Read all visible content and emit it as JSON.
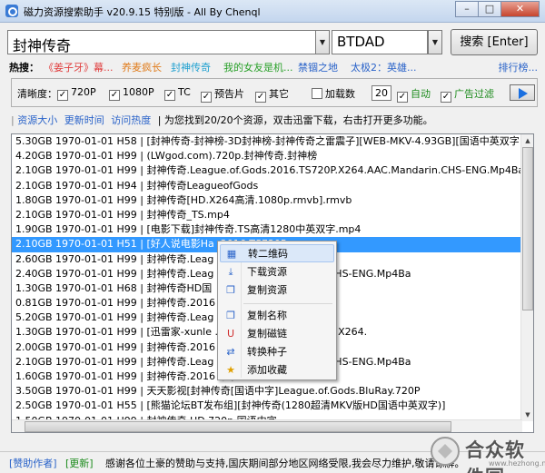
{
  "window": {
    "title": "磁力资源搜索助手 v20.9.15 特别版 - All By Chenql",
    "minimize": "–",
    "maximize": "□",
    "close": "✕"
  },
  "search": {
    "value": "封神传奇",
    "engine": "BTDAD",
    "button": "搜索 [Enter]",
    "arrow": "▼"
  },
  "hot": {
    "label": "热搜：",
    "items": [
      {
        "text": "《姜子牙》幕...",
        "color": "#e03c3c"
      },
      {
        "text": "养麦疯长",
        "color": "#e07c1c"
      },
      {
        "text": "封神传奇",
        "color": "#1fa0d0"
      },
      {
        "text": "我的女友是机...",
        "color": "#28a028"
      },
      {
        "text": "禁锢之地",
        "color": "#2a63c9"
      },
      {
        "text": "太极2：英雄...",
        "color": "#2a63c9"
      }
    ],
    "rank_link": "排行榜..."
  },
  "filters": {
    "clarity_label": "清晰度：",
    "options": [
      {
        "label": "720P",
        "checked": true
      },
      {
        "label": "1080P",
        "checked": true
      },
      {
        "label": "TC",
        "checked": true
      },
      {
        "label": "预告片",
        "checked": true
      },
      {
        "label": "其它",
        "checked": true
      }
    ],
    "load_label": "加载数",
    "load_value": "20",
    "auto_label": "自动",
    "ad_filter_label": "广告过滤"
  },
  "info": {
    "links": [
      "资源大小",
      "更新时间",
      "访问热度"
    ],
    "message": "| 为您找到20/20个资源，双击迅雷下载，右击打开更多功能。"
  },
  "results": [
    "5.30GB 1970-01-01 H58 | [封神传奇-封神榜-3D封神榜-封神传奇之雷震子][WEB-MKV-4.93GB][国语中英双字",
    "4.20GB 1970-01-01 H99 | (LWgod.com).720p.封神传奇.封神榜",
    "2.10GB 1970-01-01 H99 | 封神传奇.League.of.Gods.2016.TS720P.X264.AAC.Mandarin.CHS-ENG.Mp4Ba",
    "2.10GB 1970-01-01 H94 | 封神传奇LeagueofGods",
    "1.80GB 1970-01-01 H99 | 封神传奇[HD.X264高清.1080p.rmvb].rmvb",
    "2.10GB 1970-01-01 H99 | 封神传奇_TS.mp4",
    "1.90GB 1970-01-01 H99 | [电影下载]封神传奇.TS高清1280中英双字.mp4",
    "2.10GB 1970-01-01 H51 | [好人说电影Ha            .2016.TS720P",
    "2.60GB 1970-01-01 H99 | 封神传奇.Leag            80P.x264.中文字幕.rarbt",
    "2.40GB 1970-01-01 H99 | 封神传奇.Leag            P.X264.AAC.Mandarin.CHS-ENG.Mp4Ba",
    "1.30GB 1970-01-01 H68 | 封神传奇HD国",
    "0.81GB 1970-01-01 H99 | 封神传奇.2016",
    "5.20GB 1970-01-01 H99 | 封神传奇.Leag            WEB-DLx264AAC",
    "1.30GB 1970-01-01 H99 | [迅雷家-xunle            .中文字幕.2016.HD1080P.X264.",
    "2.00GB 1970-01-01 H99 | 封神传奇.2016            中字",
    "2.10GB 1970-01-01 H99 | 封神传奇.Leag            P.X264.AAC.Mandarin.CHS-ENG.Mp4Ba",
    "1.60GB 1970-01-01 H99 | 封神传奇.2016            中字",
    "3.50GB 1970-01-01 H99 | 天天影视[封神传奇[国语中字]League.of.Gods.BluRay.720P",
    "2.50GB 1970-01-01 H55 | [熊猫论坛BT发布组][封神传奇(1280超清MKV版HD国语中英双字)]",
    "1.50GB 1970-01-01 H99 | 封神传奇.HD.720p.国语中字"
  ],
  "selected_index": 7,
  "context_menu": {
    "items": [
      {
        "label": "转二维码",
        "icon": "qr-code-icon",
        "glyph": "▦"
      },
      {
        "label": "下载资源",
        "icon": "download-icon",
        "glyph": "⤓"
      },
      {
        "label": "复制资源",
        "icon": "copy-icon",
        "glyph": "❐"
      },
      {
        "label": "复制名称",
        "icon": "copy-name-icon",
        "glyph": "❐"
      },
      {
        "label": "复制磁链",
        "icon": "magnet-icon",
        "glyph": "U"
      },
      {
        "label": "转换种子",
        "icon": "convert-icon",
        "glyph": "⇄"
      },
      {
        "label": "添加收藏",
        "icon": "favorite-icon",
        "glyph": "★"
      }
    ]
  },
  "status": {
    "sponsor": "[赞助作者]",
    "update": "[更新]",
    "text": "感谢各位土豪的赞助与支持,国庆期间部分地区网络受限,我会尽力维护,敬请谅解。"
  },
  "watermark": {
    "text": "合众软件园",
    "sub": "www.hezhong.net"
  },
  "colors": {
    "selection": "#3399ff",
    "link": "#2a63c9",
    "green": "#1c8b1c"
  }
}
